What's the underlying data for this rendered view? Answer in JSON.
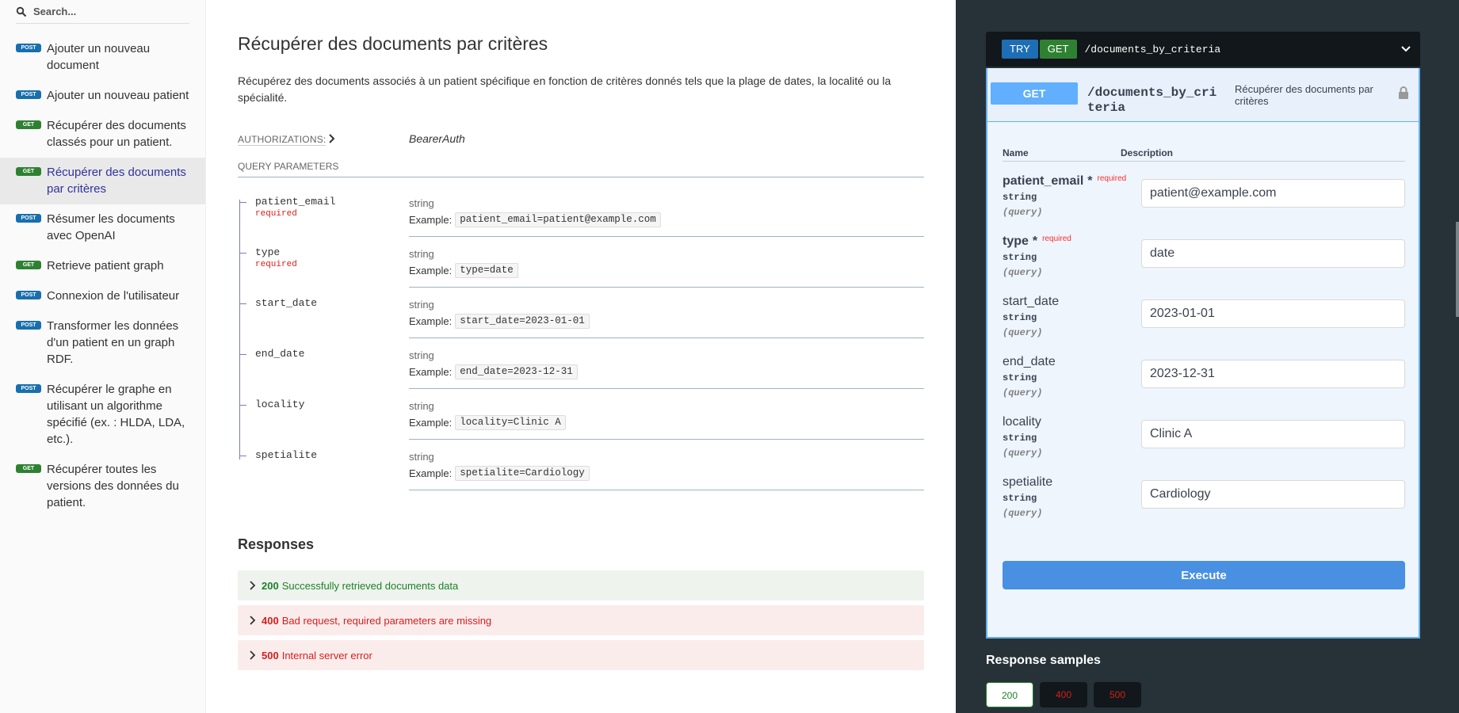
{
  "sidebar": {
    "search_placeholder": "Search...",
    "items": [
      {
        "method": "POST",
        "label": "Ajouter un nouveau document"
      },
      {
        "method": "POST",
        "label": "Ajouter un nouveau patient"
      },
      {
        "method": "GET",
        "label": "Récupérer des documents classés pour un patient."
      },
      {
        "method": "GET",
        "label": "Récupérer des documents par critères"
      },
      {
        "method": "POST",
        "label": "Résumer les documents avec OpenAI"
      },
      {
        "method": "GET",
        "label": "Retrieve patient graph"
      },
      {
        "method": "POST",
        "label": "Connexion de l'utilisateur"
      },
      {
        "method": "POST",
        "label": "Transformer les données d'un patient en un graph RDF."
      },
      {
        "method": "POST",
        "label": "Récupérer le graphe en utilisant un algorithme spécifié (ex. : HLDA, LDA, etc.)."
      },
      {
        "method": "GET",
        "label": "Récupérer toutes les versions des données du patient."
      }
    ]
  },
  "operation": {
    "title": "Récupérer des documents par critères",
    "description": "Récupérez des documents associés à un patient spécifique en fonction de critères donnés tels que la plage de dates, la localité ou la spécialité.",
    "auth_label": "AUTHORIZATIONS:",
    "auth_value": "BearerAuth",
    "query_label": "QUERY PARAMETERS",
    "example_label": "Example:",
    "required_label": "required",
    "params": [
      {
        "name": "patient_email",
        "required": true,
        "type": "string",
        "example": "patient_email=patient@example.com"
      },
      {
        "name": "type",
        "required": true,
        "type": "string",
        "example": "type=date"
      },
      {
        "name": "start_date",
        "required": false,
        "type": "string",
        "example": "start_date=2023-01-01"
      },
      {
        "name": "end_date",
        "required": false,
        "type": "string",
        "example": "end_date=2023-12-31"
      },
      {
        "name": "locality",
        "required": false,
        "type": "string",
        "example": "locality=Clinic A"
      },
      {
        "name": "spetialite",
        "required": false,
        "type": "string",
        "example": "spetialite=Cardiology"
      }
    ],
    "responses_title": "Responses",
    "responses": [
      {
        "code": "200",
        "text": "Successfully retrieved documents data",
        "kind": "ok"
      },
      {
        "code": "400",
        "text": "Bad request, required parameters are missing",
        "kind": "err"
      },
      {
        "code": "500",
        "text": "Internal server error",
        "kind": "err"
      }
    ]
  },
  "console": {
    "try_label": "TRY",
    "method": "GET",
    "path": "/documents_by_criteria",
    "path_wrapped": "/documents_by_criteria",
    "summary": "Récupérer des documents par critères",
    "col_name": "Name",
    "col_desc": "Description",
    "required_mark": "*",
    "required_label": "required",
    "in_label": "(query)",
    "fields": [
      {
        "name": "patient_email",
        "required": true,
        "type": "string",
        "value": "patient@example.com"
      },
      {
        "name": "type",
        "required": true,
        "type": "string",
        "value": "date"
      },
      {
        "name": "start_date",
        "required": false,
        "type": "string",
        "value": "2023-01-01"
      },
      {
        "name": "end_date",
        "required": false,
        "type": "string",
        "value": "2023-12-31"
      },
      {
        "name": "locality",
        "required": false,
        "type": "string",
        "value": "Clinic A"
      },
      {
        "name": "spetialite",
        "required": false,
        "type": "string",
        "value": "Cardiology"
      }
    ],
    "execute_label": "Execute",
    "samples_title": "Response samples",
    "sample_tabs": [
      "200",
      "400",
      "500"
    ]
  },
  "colors": {
    "post": "#186fad",
    "get": "#2f8132",
    "accent": "#32329f",
    "panel": "#263238"
  }
}
